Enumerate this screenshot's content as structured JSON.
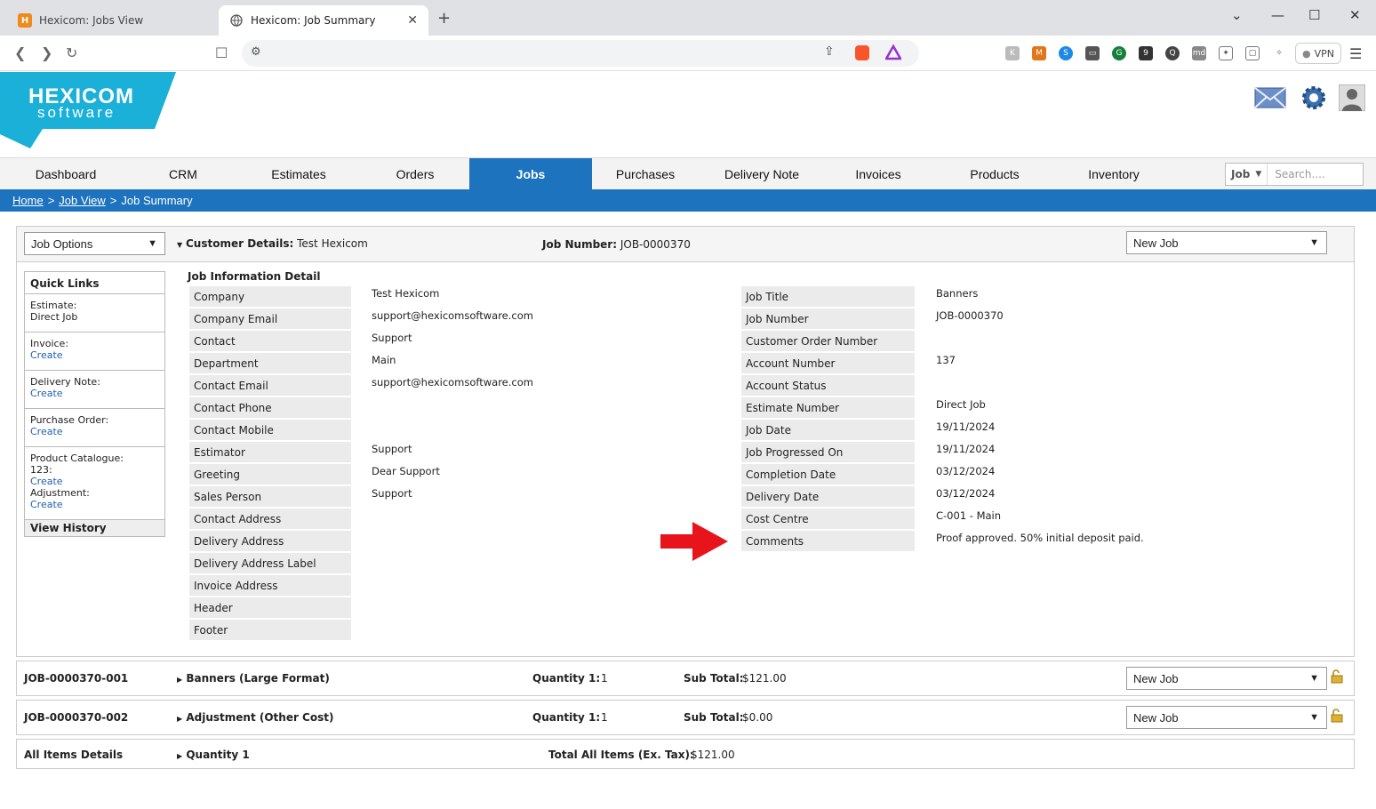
{
  "browser": {
    "tabs": [
      {
        "title": "Hexicom: Jobs View",
        "active": false
      },
      {
        "title": "Hexicom: Job Summary",
        "active": true
      }
    ],
    "vpn_label": "VPN"
  },
  "logo": {
    "line1": "HEXICOM",
    "line2": "software"
  },
  "nav": {
    "items": [
      "Dashboard",
      "CRM",
      "Estimates",
      "Orders",
      "Jobs",
      "Purchases",
      "Delivery Note",
      "Invoices",
      "Products",
      "Inventory"
    ],
    "active": "Jobs",
    "search_type": "Job",
    "search_placeholder": "Search...."
  },
  "breadcrumb": {
    "home": "Home",
    "sep1": ">",
    "job_view": "Job View",
    "sep2": ">",
    "current": "Job Summary"
  },
  "header": {
    "job_options": "Job Options",
    "customer_details_label": "Customer Details:",
    "customer_details_value": "Test Hexicom",
    "job_number_label": "Job Number:",
    "job_number_value": "JOB-0000370",
    "status": "New Job"
  },
  "quick_links": {
    "title": "Quick Links",
    "estimate_label": "Estimate:",
    "estimate_value": "Direct Job",
    "invoice_label": "Invoice:",
    "invoice_link": "Create",
    "delivery_label": "Delivery Note:",
    "delivery_link": "Create",
    "po_label": "Purchase Order:",
    "po_link": "Create",
    "catalogue_label": "Product Catalogue:",
    "catalogue_sub": "123:",
    "catalogue_link": "Create",
    "adjustment_label": "Adjustment:",
    "adjustment_link": "Create",
    "history": "View History"
  },
  "job_info": {
    "title": "Job Information Detail",
    "left": [
      {
        "label": "Company",
        "value": "Test Hexicom"
      },
      {
        "label": "Company Email",
        "value": "support@hexicomsoftware.com"
      },
      {
        "label": "Contact",
        "value": "Support"
      },
      {
        "label": "Department",
        "value": "Main"
      },
      {
        "label": "Contact Email",
        "value": "support@hexicomsoftware.com"
      },
      {
        "label": "Contact Phone",
        "value": ""
      },
      {
        "label": "Contact Mobile",
        "value": ""
      },
      {
        "label": "Estimator",
        "value": "Support"
      },
      {
        "label": "Greeting",
        "value": "Dear Support"
      },
      {
        "label": "Sales Person",
        "value": "Support"
      },
      {
        "label": "Contact Address",
        "value": ""
      },
      {
        "label": "Delivery Address",
        "value": ""
      },
      {
        "label": "Delivery Address Label",
        "value": ""
      },
      {
        "label": "Invoice Address",
        "value": ""
      },
      {
        "label": "Header",
        "value": ""
      },
      {
        "label": "Footer",
        "value": ""
      }
    ],
    "right": [
      {
        "label": "Job Title",
        "value": "Banners"
      },
      {
        "label": "Job Number",
        "value": "JOB-0000370"
      },
      {
        "label": "Customer Order Number",
        "value": ""
      },
      {
        "label": "Account Number",
        "value": "137"
      },
      {
        "label": "Account Status",
        "value": ""
      },
      {
        "label": "Estimate Number",
        "value": "Direct Job"
      },
      {
        "label": "Job Date",
        "value": "19/11/2024"
      },
      {
        "label": "Job Progressed On",
        "value": "19/11/2024"
      },
      {
        "label": "Completion Date",
        "value": "03/12/2024"
      },
      {
        "label": "Delivery Date",
        "value": "03/12/2024"
      },
      {
        "label": "Cost Centre",
        "value": "C-001 - Main"
      },
      {
        "label": "Comments",
        "value": "Proof approved. 50% initial deposit paid."
      }
    ]
  },
  "items": [
    {
      "code": "JOB-0000370-001",
      "name": "Banners (Large Format)",
      "qty_label": "Quantity 1:",
      "qty": "1",
      "sub_label": "Sub Total:",
      "sub": "$121.00",
      "status": "New Job"
    },
    {
      "code": "JOB-0000370-002",
      "name": "Adjustment (Other Cost)",
      "qty_label": "Quantity 1:",
      "qty": "1",
      "sub_label": "Sub Total:",
      "sub": "$0.00",
      "status": "New Job"
    }
  ],
  "totals": {
    "label": "All Items Details",
    "qty": "Quantity 1",
    "total_label": "Total All Items (Ex. Tax):",
    "total": "$121.00"
  },
  "colors": {
    "brand": "#1e73be",
    "logo": "#1ab0d8",
    "arrow": "#e8141c"
  }
}
